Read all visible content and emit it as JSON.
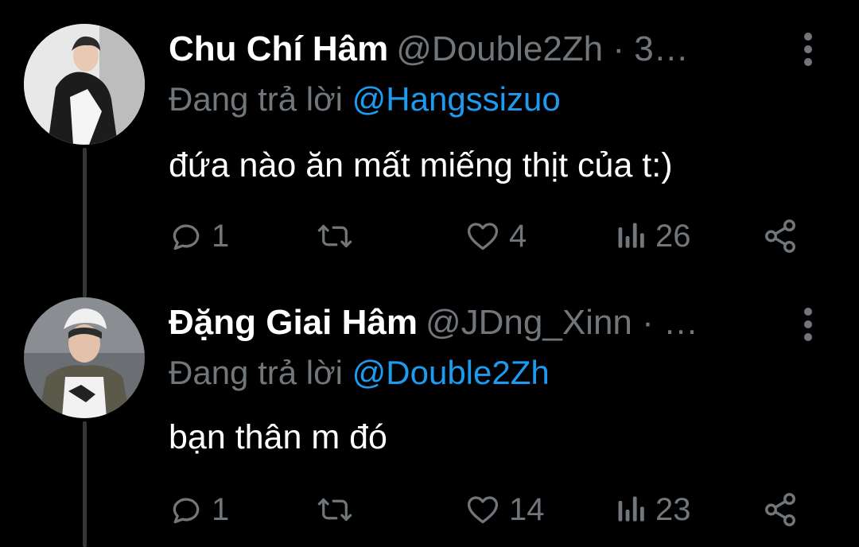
{
  "tweets": [
    {
      "display_name": "Chu Chí Hâm",
      "handle_time": "@Double2Zh · 3…",
      "reply_prefix": "Đang trả lời",
      "reply_to": "@Hangssizuo",
      "text": "đứa nào ăn mất miếng thịt của t:)",
      "replies": "1",
      "retweets": "",
      "likes": "4",
      "views": "26"
    },
    {
      "display_name": "Đặng Giai Hâm",
      "handle_time": "@JDng_Xinn · …",
      "reply_prefix": "Đang trả lời",
      "reply_to": "@Double2Zh",
      "text": "bạn thân m đó",
      "replies": "1",
      "retweets": "",
      "likes": "14",
      "views": "23"
    }
  ],
  "icons": {
    "reply": "reply-icon",
    "retweet": "retweet-icon",
    "like": "heart-icon",
    "views": "views-icon",
    "share": "share-icon",
    "more": "more-vertical-icon"
  },
  "colors": {
    "background": "#000000",
    "primary_text": "#ffffff",
    "secondary_text": "#71767b",
    "accent": "#1d9bf0",
    "thread_line": "#333639"
  }
}
